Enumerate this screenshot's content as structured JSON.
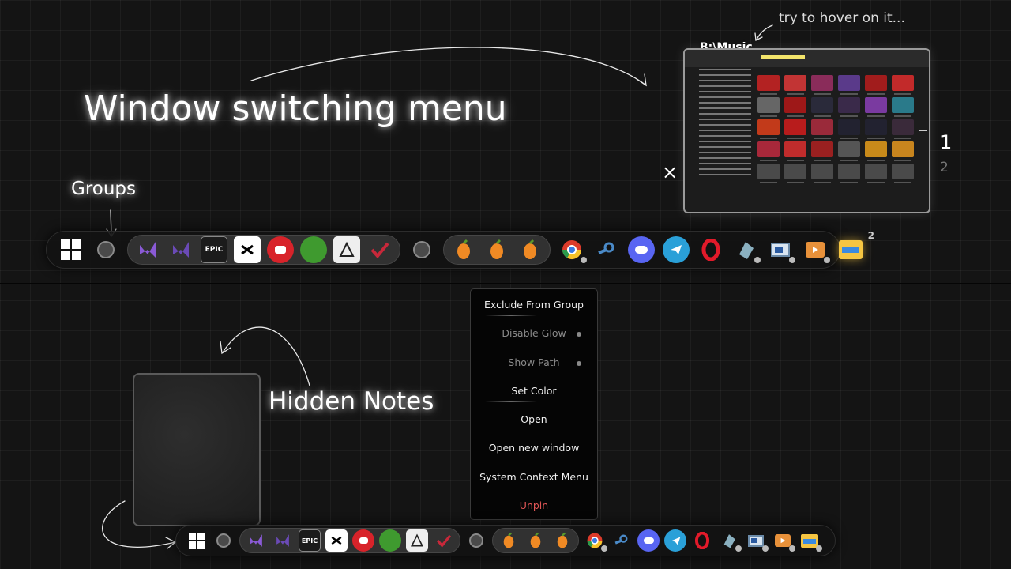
{
  "annotations": {
    "window_switching": "Window switching menu",
    "groups": "Groups",
    "hover_hint": "try to hover on it...",
    "hidden_notes": "Hidden Notes"
  },
  "preview": {
    "title": "B:\\Music",
    "close_symbol": "×",
    "pages": [
      "1",
      "2"
    ],
    "active_page": "1"
  },
  "taskbar_top": {
    "start_icon": "windows-icon",
    "group1": [
      "visual-studio-icon",
      "visual-studio-icon",
      "epic-games-icon",
      "capcut-icon",
      "red-app-icon",
      "green-app-icon",
      "zbrush-icon",
      "red-check-icon"
    ],
    "epic_label": "EPIC",
    "group2": [
      "fl-studio-icon",
      "fl-studio-icon",
      "fl-studio-icon"
    ],
    "standalone": [
      "chrome-icon",
      "steam-icon",
      "discord-icon",
      "telegram-icon",
      "opera-icon",
      "3d-app-icon",
      "window-app-icon",
      "media-player-icon",
      "file-explorer-icon"
    ],
    "explorer_badge": "2"
  },
  "context_menu": {
    "items": [
      {
        "label": "Exclude From Group",
        "state": "normal"
      },
      {
        "label": "Disable Glow",
        "state": "dim"
      },
      {
        "label": "Show Path",
        "state": "dim"
      },
      {
        "label": "Set Color",
        "state": "normal"
      },
      {
        "label": "Open",
        "state": "normal"
      },
      {
        "label": "Open new window",
        "state": "normal"
      },
      {
        "label": "System Context Menu",
        "state": "normal"
      },
      {
        "label": "Unpin",
        "state": "danger"
      }
    ]
  },
  "colors": {
    "background": "#141414",
    "unpin": "#e25656",
    "fl_orange": "#f08a24",
    "explorer_yellow": "#f5c542"
  }
}
